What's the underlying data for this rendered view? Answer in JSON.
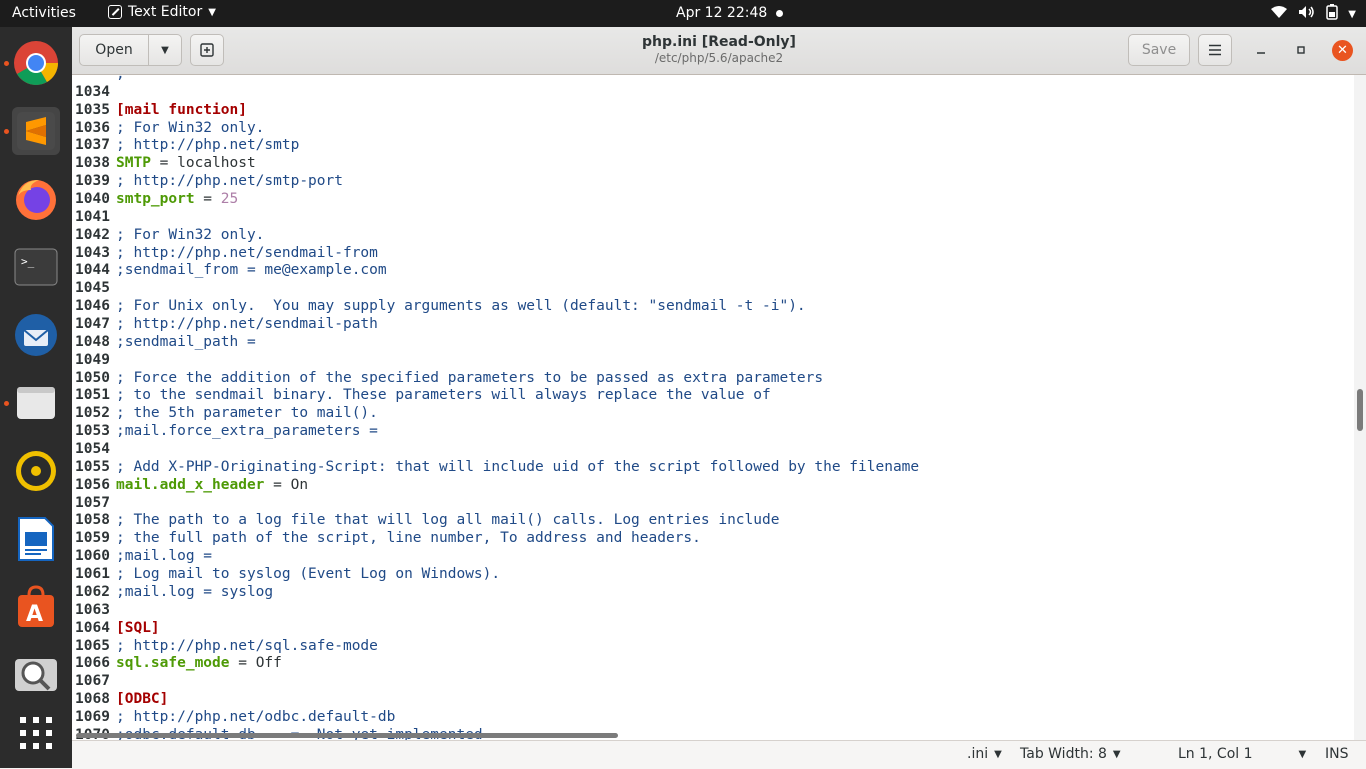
{
  "topbar": {
    "activities": "Activities",
    "app_name": "Text Editor",
    "clock": "Apr 12  22:48"
  },
  "dock": {
    "items": [
      {
        "name": "chrome",
        "running": true
      },
      {
        "name": "sublime-text",
        "running": true,
        "active": true
      },
      {
        "name": "firefox",
        "running": false
      },
      {
        "name": "terminal",
        "running": false
      },
      {
        "name": "thunderbird",
        "running": false
      },
      {
        "name": "files",
        "running": true
      },
      {
        "name": "rhythmbox",
        "running": false
      },
      {
        "name": "libreoffice-writer",
        "running": false
      },
      {
        "name": "ubuntu-software",
        "running": false
      },
      {
        "name": "screenshot",
        "running": false
      }
    ]
  },
  "headerbar": {
    "open_label": "Open",
    "save_label": "Save",
    "title": "php.ini [Read-Only]",
    "subtitle": "/etc/php/5.6/apache2"
  },
  "editor": {
    "lines": [
      {
        "n": "",
        "segs": [
          {
            "t": ";",
            "c": "comment"
          }
        ]
      },
      {
        "n": "1034",
        "segs": []
      },
      {
        "n": "1035",
        "segs": [
          {
            "t": "[mail function]",
            "c": "section"
          }
        ]
      },
      {
        "n": "1036",
        "segs": [
          {
            "t": "; For Win32 only.",
            "c": "comment"
          }
        ]
      },
      {
        "n": "1037",
        "segs": [
          {
            "t": "; http://php.net/smtp",
            "c": "comment"
          }
        ]
      },
      {
        "n": "1038",
        "segs": [
          {
            "t": "SMTP",
            "c": "key"
          },
          {
            "t": " = ",
            "c": "op"
          },
          {
            "t": "localhost",
            "c": "val"
          }
        ]
      },
      {
        "n": "1039",
        "segs": [
          {
            "t": "; http://php.net/smtp-port",
            "c": "comment"
          }
        ]
      },
      {
        "n": "1040",
        "segs": [
          {
            "t": "smtp_port",
            "c": "key"
          },
          {
            "t": " = ",
            "c": "op"
          },
          {
            "t": "25",
            "c": "num"
          }
        ]
      },
      {
        "n": "1041",
        "segs": []
      },
      {
        "n": "1042",
        "segs": [
          {
            "t": "; For Win32 only.",
            "c": "comment"
          }
        ]
      },
      {
        "n": "1043",
        "segs": [
          {
            "t": "; http://php.net/sendmail-from",
            "c": "comment"
          }
        ]
      },
      {
        "n": "1044",
        "segs": [
          {
            "t": ";sendmail_from = me@example.com",
            "c": "comment"
          }
        ]
      },
      {
        "n": "1045",
        "segs": []
      },
      {
        "n": "1046",
        "segs": [
          {
            "t": "; For Unix only.  You may supply arguments as well (default: \"sendmail -t -i\").",
            "c": "comment"
          }
        ]
      },
      {
        "n": "1047",
        "segs": [
          {
            "t": "; http://php.net/sendmail-path",
            "c": "comment"
          }
        ]
      },
      {
        "n": "1048",
        "segs": [
          {
            "t": ";sendmail_path =",
            "c": "comment"
          }
        ]
      },
      {
        "n": "1049",
        "segs": []
      },
      {
        "n": "1050",
        "segs": [
          {
            "t": "; Force the addition of the specified parameters to be passed as extra parameters",
            "c": "comment"
          }
        ]
      },
      {
        "n": "1051",
        "segs": [
          {
            "t": "; to the sendmail binary. These parameters will always replace the value of",
            "c": "comment"
          }
        ]
      },
      {
        "n": "1052",
        "segs": [
          {
            "t": "; the 5th parameter to mail().",
            "c": "comment"
          }
        ]
      },
      {
        "n": "1053",
        "segs": [
          {
            "t": ";mail.force_extra_parameters =",
            "c": "comment"
          }
        ]
      },
      {
        "n": "1054",
        "segs": []
      },
      {
        "n": "1055",
        "segs": [
          {
            "t": "; Add X-PHP-Originating-Script: that will include uid of the script followed by the filename",
            "c": "comment"
          }
        ]
      },
      {
        "n": "1056",
        "segs": [
          {
            "t": "mail.add_x_header",
            "c": "key"
          },
          {
            "t": " = ",
            "c": "op"
          },
          {
            "t": "On",
            "c": "val"
          }
        ]
      },
      {
        "n": "1057",
        "segs": []
      },
      {
        "n": "1058",
        "segs": [
          {
            "t": "; The path to a log file that will log all mail() calls. Log entries include",
            "c": "comment"
          }
        ]
      },
      {
        "n": "1059",
        "segs": [
          {
            "t": "; the full path of the script, line number, To address and headers.",
            "c": "comment"
          }
        ]
      },
      {
        "n": "1060",
        "segs": [
          {
            "t": ";mail.log =",
            "c": "comment"
          }
        ]
      },
      {
        "n": "1061",
        "segs": [
          {
            "t": "; Log mail to syslog (Event Log on Windows).",
            "c": "comment"
          }
        ]
      },
      {
        "n": "1062",
        "segs": [
          {
            "t": ";mail.log = syslog",
            "c": "comment"
          }
        ]
      },
      {
        "n": "1063",
        "segs": []
      },
      {
        "n": "1064",
        "segs": [
          {
            "t": "[SQL]",
            "c": "section"
          }
        ]
      },
      {
        "n": "1065",
        "segs": [
          {
            "t": "; http://php.net/sql.safe-mode",
            "c": "comment"
          }
        ]
      },
      {
        "n": "1066",
        "segs": [
          {
            "t": "sql.safe_mode",
            "c": "key"
          },
          {
            "t": " = ",
            "c": "op"
          },
          {
            "t": "Off",
            "c": "val"
          }
        ]
      },
      {
        "n": "1067",
        "segs": []
      },
      {
        "n": "1068",
        "segs": [
          {
            "t": "[ODBC]",
            "c": "section"
          }
        ]
      },
      {
        "n": "1069",
        "segs": [
          {
            "t": "; http://php.net/odbc.default-db",
            "c": "comment"
          }
        ]
      },
      {
        "n": "1070",
        "segs": [
          {
            "t": ";odbc.default_db    =  Not yet implemented",
            "c": "comment"
          }
        ]
      }
    ]
  },
  "statusbar": {
    "language": ".ini",
    "tab_width": "Tab Width: 8",
    "cursor": "Ln 1, Col 1",
    "mode": "INS"
  },
  "colors": {
    "accent": "#e95420",
    "comment": "#204a87",
    "section": "#a40000",
    "key": "#4e9a06",
    "number": "#ad7fa8"
  }
}
